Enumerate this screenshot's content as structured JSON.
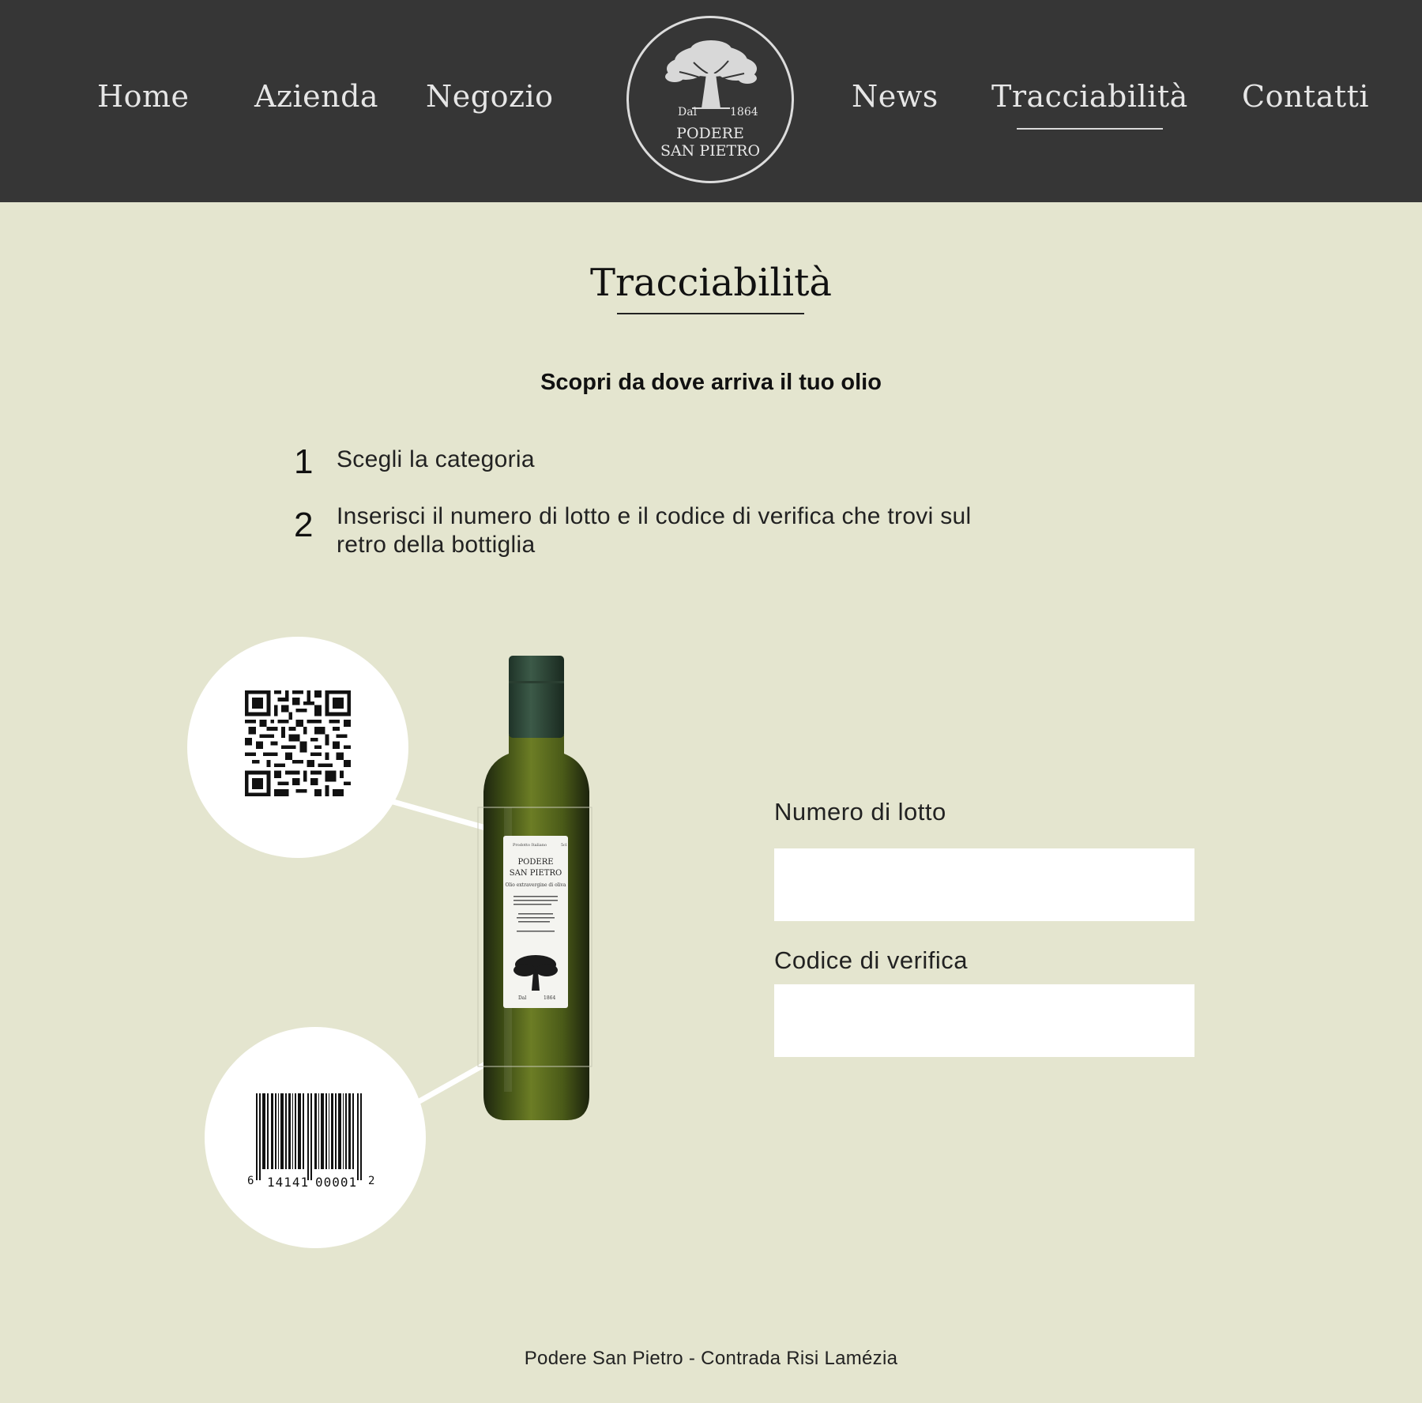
{
  "nav": {
    "items": [
      {
        "label": "Home"
      },
      {
        "label": "Azienda"
      },
      {
        "label": "Negozio"
      },
      {
        "label": "News"
      },
      {
        "label": "Tracciabilità",
        "active": true
      },
      {
        "label": "Contatti"
      }
    ]
  },
  "logo": {
    "dal": "Dal",
    "year": "1864",
    "line1": "PODERE",
    "line2": "SAN PIETRO",
    "icon": "olive-tree-icon"
  },
  "main": {
    "title": "Tracciabilità",
    "subtitle": "Scopri da dove arriva il tuo olio",
    "steps": [
      {
        "number": "1",
        "text": "Scegli la categoria"
      },
      {
        "number": "2",
        "text_line1": "Inserisci il numero di lotto e il codice di verifica che trovi sul",
        "text_line2": "retro della bottiglia"
      }
    ]
  },
  "illustration": {
    "qr_icon": "qr-code-icon",
    "barcode_icon": "barcode-icon",
    "barcode_digits": [
      "6",
      "14141",
      "00001",
      "2"
    ],
    "bottle_label": {
      "top_left": "Prodotto Italiano",
      "top_right": "5cl",
      "brand_line1": "PODERE",
      "brand_line2": "SAN PIETRO",
      "product": "Olio extravergine di oliva",
      "dal": "Dal",
      "year": "1864"
    }
  },
  "form": {
    "lot_label": "Numero di lotto",
    "lot_value": "",
    "code_label": "Codice di verifica",
    "code_value": ""
  },
  "footer": {
    "text": "Podere San Pietro - Contrada Risi Lamézia"
  },
  "colors": {
    "header_bg": "#363636",
    "page_bg": "#e4e5cf",
    "bottle_green": "#5a6a1e",
    "cap_green": "#2f4a3a"
  }
}
